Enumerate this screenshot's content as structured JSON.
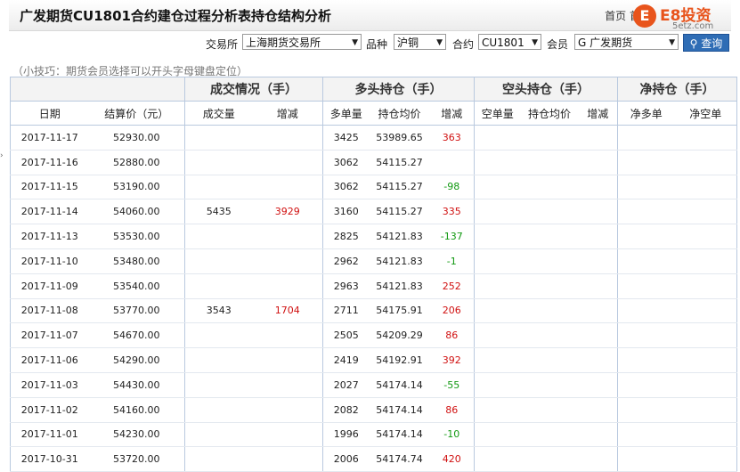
{
  "title": "广发期货CU1801合约建仓过程分析表持仓结构分析",
  "title_right": "首页 首页",
  "logo": {
    "mark": "E",
    "brand": "E8投资",
    "site": "5etz.com"
  },
  "filters": {
    "exchange_label": "交易所",
    "exchange_value": "上海期货交易所",
    "variety_label": "品种",
    "variety_value": "沪铜",
    "contract_label": "合约",
    "contract_value": "CU1801",
    "member_label": "会员",
    "member_value": "G 广发期货",
    "query_label": "查询"
  },
  "tip": "（小技巧：期货会员选择可以开头字母键盘定位）",
  "table": {
    "groups": [
      "成交情况（手）",
      "多头持仓（手）",
      "空头持仓（手）",
      "净持仓（手）"
    ],
    "columns": [
      "日期",
      "结算价（元）",
      "成交量",
      "增减",
      "多单量",
      "持仓均价",
      "增减",
      "空单量",
      "持仓均价",
      "增减",
      "净多单",
      "净空单"
    ],
    "rows": [
      {
        "date": "2017-11-17",
        "settle": "52930.00",
        "vol": "",
        "vol_chg": "",
        "long": "3425",
        "long_avg": "53989.65",
        "long_chg": "363"
      },
      {
        "date": "2017-11-16",
        "settle": "52880.00",
        "vol": "",
        "vol_chg": "",
        "long": "3062",
        "long_avg": "54115.27",
        "long_chg": ""
      },
      {
        "date": "2017-11-15",
        "settle": "53190.00",
        "vol": "",
        "vol_chg": "",
        "long": "3062",
        "long_avg": "54115.27",
        "long_chg": "-98"
      },
      {
        "date": "2017-11-14",
        "settle": "54060.00",
        "vol": "5435",
        "vol_chg": "3929",
        "long": "3160",
        "long_avg": "54115.27",
        "long_chg": "335"
      },
      {
        "date": "2017-11-13",
        "settle": "53530.00",
        "vol": "",
        "vol_chg": "",
        "long": "2825",
        "long_avg": "54121.83",
        "long_chg": "-137"
      },
      {
        "date": "2017-11-10",
        "settle": "53480.00",
        "vol": "",
        "vol_chg": "",
        "long": "2962",
        "long_avg": "54121.83",
        "long_chg": "-1"
      },
      {
        "date": "2017-11-09",
        "settle": "53540.00",
        "vol": "",
        "vol_chg": "",
        "long": "2963",
        "long_avg": "54121.83",
        "long_chg": "252"
      },
      {
        "date": "2017-11-08",
        "settle": "53770.00",
        "vol": "3543",
        "vol_chg": "1704",
        "long": "2711",
        "long_avg": "54175.91",
        "long_chg": "206"
      },
      {
        "date": "2017-11-07",
        "settle": "54670.00",
        "vol": "",
        "vol_chg": "",
        "long": "2505",
        "long_avg": "54209.29",
        "long_chg": "86"
      },
      {
        "date": "2017-11-06",
        "settle": "54290.00",
        "vol": "",
        "vol_chg": "",
        "long": "2419",
        "long_avg": "54192.91",
        "long_chg": "392"
      },
      {
        "date": "2017-11-03",
        "settle": "54430.00",
        "vol": "",
        "vol_chg": "",
        "long": "2027",
        "long_avg": "54174.14",
        "long_chg": "-55"
      },
      {
        "date": "2017-11-02",
        "settle": "54160.00",
        "vol": "",
        "vol_chg": "",
        "long": "2082",
        "long_avg": "54174.14",
        "long_chg": "86"
      },
      {
        "date": "2017-11-01",
        "settle": "54230.00",
        "vol": "",
        "vol_chg": "",
        "long": "1996",
        "long_avg": "54174.14",
        "long_chg": "-10"
      },
      {
        "date": "2017-10-31",
        "settle": "53720.00",
        "vol": "",
        "vol_chg": "",
        "long": "2006",
        "long_avg": "54174.74",
        "long_chg": "420"
      }
    ]
  },
  "colors": {
    "increase": "#d01010",
    "decrease": "#119911",
    "button": "#2f6db5",
    "brand": "#e8541c"
  }
}
